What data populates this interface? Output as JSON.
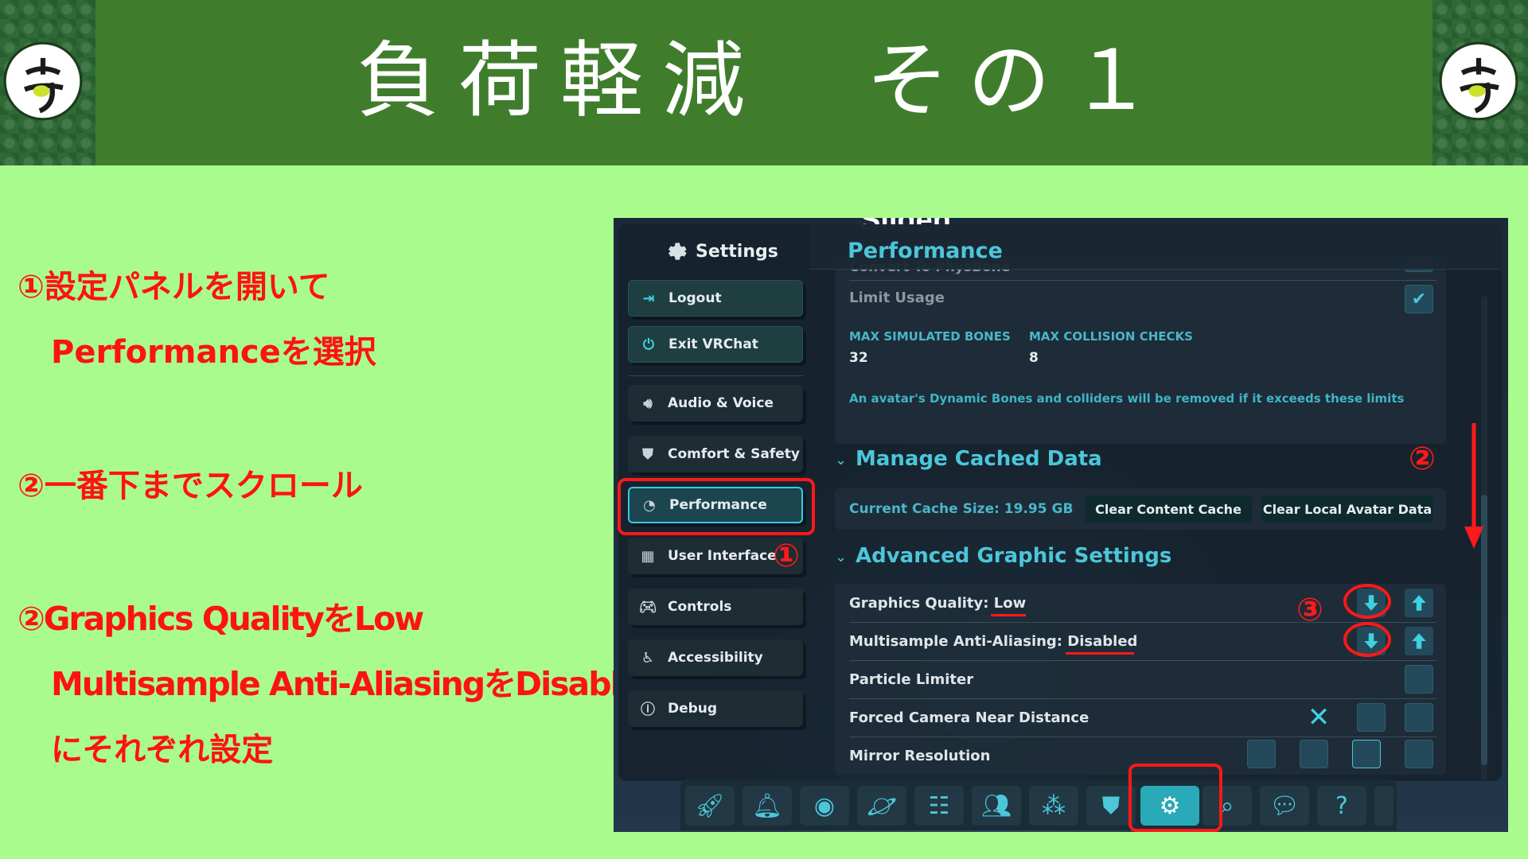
{
  "header": {
    "title": "負荷軽減　その１"
  },
  "instructions": {
    "step1_line1": "①設定パネルを開いて",
    "step1_line2": "Performanceを選択",
    "step2": "②一番下までスクロール",
    "step3_line1": "②Graphics QualityをLow",
    "step3_line2": "Multisample Anti-AliasingをDisabled",
    "step3_line3": "にそれぞれ設定"
  },
  "screenshot": {
    "world_name": "Silden",
    "sidebar": {
      "title": "Settings",
      "items": [
        {
          "label": "Logout",
          "icon": "logout-icon"
        },
        {
          "label": "Exit VRChat",
          "icon": "power-icon"
        },
        {
          "label": "Audio & Voice",
          "icon": "speaker-icon"
        },
        {
          "label": "Comfort & Safety",
          "icon": "shield-icon"
        },
        {
          "label": "Performance",
          "icon": "gauge-icon"
        },
        {
          "label": "User Interface",
          "icon": "grid-icon"
        },
        {
          "label": "Controls",
          "icon": "gamepad-icon"
        },
        {
          "label": "Accessibility",
          "icon": "accessibility-icon"
        },
        {
          "label": "Debug",
          "icon": "info-icon"
        }
      ]
    },
    "content": {
      "title": "Performance",
      "convert_physbone": "Convert To PhysBone",
      "limit_usage": "Limit Usage",
      "max_bones_label": "MAX SIMULATED BONES",
      "max_bones_value": "32",
      "max_collision_label": "MAX COLLISION CHECKS",
      "max_collision_value": "8",
      "bones_note": "An avatar's Dynamic Bones and colliders will be removed if it exceeds these limits",
      "cache_section": "Manage Cached Data",
      "cache_size": "Current Cache Size: 19.95 GB",
      "clear_content_cache": "Clear Content Cache",
      "clear_local_avatar": "Clear Local Avatar Data",
      "advanced_section": "Advanced Graphic Settings",
      "graphics_quality_label": "Graphics Quality:",
      "graphics_quality_value": "Low",
      "msaa_label": "Multisample Anti-Aliasing:",
      "msaa_value": "Disabled",
      "particle_limiter": "Particle Limiter",
      "forced_camera": "Forced Camera Near Distance",
      "mirror_resolution": "Mirror Resolution"
    },
    "markers": {
      "one": "①",
      "two": "②",
      "three": "③"
    },
    "colors": {
      "accent": "#4cc6d9",
      "annotation": "#ff1a1a",
      "header_green": "#3f7d2d",
      "background": "#aafb8e"
    }
  }
}
